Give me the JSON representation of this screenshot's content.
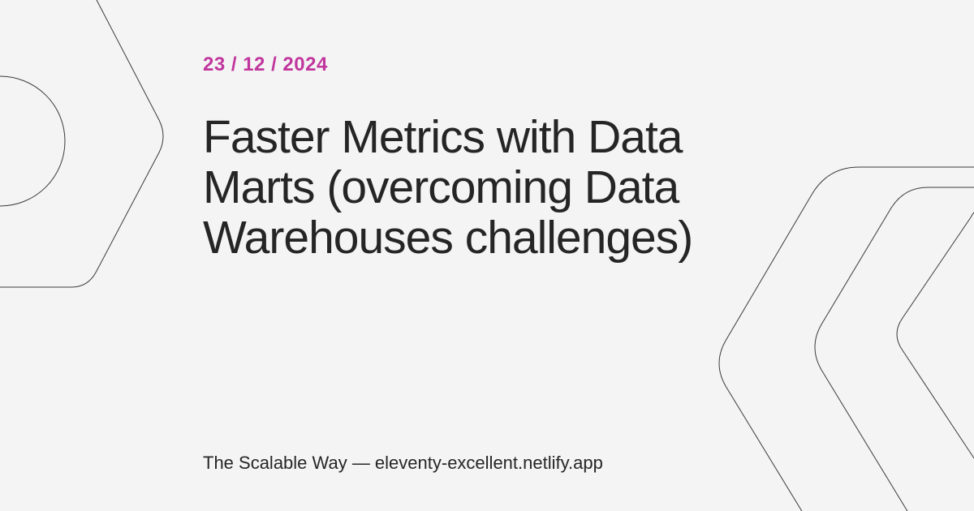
{
  "card": {
    "date": "23 / 12 / 2024",
    "title": "Faster Metrics with Data Marts (overcoming Data Warehouses challenges)",
    "footer": "The Scalable Way — eleventy-excellent.netlify.app"
  },
  "colors": {
    "background": "#f4f4f4",
    "date_accent": "#c1369d",
    "text": "#262626",
    "line_art": "#3a3a3a"
  }
}
